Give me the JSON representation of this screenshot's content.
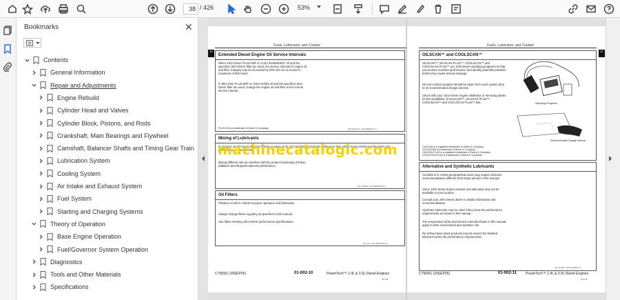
{
  "toolbar": {
    "current_page": "38",
    "total_pages": "/ 426",
    "zoom": "53%"
  },
  "bookmarks": {
    "title": "Bookmarks",
    "items": [
      {
        "label": "Contents",
        "level": 0,
        "expanded": true
      },
      {
        "label": "General Information",
        "level": 1,
        "expanded": false
      },
      {
        "label": "Repair and Adjustments",
        "level": 1,
        "expanded": true,
        "underline": true
      },
      {
        "label": "Engine Rebuild",
        "level": 2,
        "expanded": false
      },
      {
        "label": "Cylinder Head and Valves",
        "level": 2,
        "expanded": false
      },
      {
        "label": "Cylinder Block, Pistons, and Rods",
        "level": 2,
        "expanded": false
      },
      {
        "label": "Crankshaft, Main Bearings and Flywheel",
        "level": 2,
        "expanded": false
      },
      {
        "label": "Camshaft, Balancer Shafts and Timing Gear Train",
        "level": 2,
        "expanded": false
      },
      {
        "label": "Lubrication System",
        "level": 2,
        "expanded": false
      },
      {
        "label": "Cooling System",
        "level": 2,
        "expanded": false
      },
      {
        "label": "Air Intake and Exhaust System",
        "level": 2,
        "expanded": false
      },
      {
        "label": "Fuel System",
        "level": 2,
        "expanded": false
      },
      {
        "label": "Starting and Charging Systems",
        "level": 2,
        "expanded": false
      },
      {
        "label": "Theory of Operation",
        "level": 1,
        "expanded": true
      },
      {
        "label": "Base Engine Operation",
        "level": 2,
        "expanded": false
      },
      {
        "label": "Fuel/Governor System Operation",
        "level": 2,
        "expanded": false
      },
      {
        "label": "Diagnostics",
        "level": 1,
        "expanded": false
      },
      {
        "label": "Tools and Other Materials",
        "level": 1,
        "expanded": false
      },
      {
        "label": "Specifications",
        "level": 1,
        "expanded": false
      }
    ]
  },
  "left_page": {
    "header": "Fuels, Lubricants, and Coolant",
    "tab": "10",
    "sections": [
      {
        "title": "Extended Diesel Engine Oil Service Intervals",
        "paras": [
          "When John Deere PLUS-50® or ACEA-E4/E5/E6/E7 oil and the specified John Deere filter are used, the service interval for engine oil and filter changes may be increased by 50% but not to exceed a maximum of 500 hours.",
          "If other than PLUS-50® or ACEA-E4/E5 oil and the specified John Deere filter are used, change the engine oil and filter at the normal service interval."
        ],
        "note": "PLUS-50 is a trademark of Deere & Company",
        "code": "DX,ENOIL12 -19-14MAR02-1/1"
      },
      {
        "title": "Mixing of Lubricants",
        "paras": [
          "In general, avoid mixing different brands or types of oil. Oil manufacturers blend additives in their oils to meet certain specifications and performance requirements.",
          "Mixing different oils can interfere with the proper functioning of these additives and degrade lubricant performance."
        ],
        "code": "DX,LUBMIX -19-18MAR96-1/1"
      },
      {
        "title": "Oil Filters",
        "paras": [
          "Filtration of oils is critical to proper operation and lubrication.",
          "Always change filters regularly as specified in this manual.",
          "Use filters meeting John Deere performance specifications."
        ],
        "code": "DX,FILT -19-18MAR96-1/1"
      }
    ],
    "footer_left": "CTM301 (29SEP05)",
    "footer_center": "01-002-10",
    "footer_right": "PowerTech™ 2.4L & 3.0L Diesel Engines",
    "footer_page": "PN=38"
  },
  "right_page": {
    "header": "Fuels, Lubricants, and Coolant",
    "tab": "01",
    "sections": [
      {
        "title": "OILSCAN™ and COOLSCAN™",
        "paras": [
          "OILSCAN™, OILSCAN PLUS™, COOLSCAN™ and COOLSCAN PLUS™ are John Deere sampling programs to help you monitor machine performance and identify potential problems before they cause serious damage.",
          "Oil and coolant samples should be taken from each system prior to its recommended change interval.",
          "Check with your John Deere engine distributor or servicing dealer for the availability of OILSCAN™, OILSCAN PLUS™, COOLSCAN™ and COOLSCAN PLUS™ kits."
        ],
        "caption1": "Sampling Programs",
        "caption2": "Recommended Change Interval",
        "notes": [
          "OILSCAN is a registered trademark of Deere & Company.",
          "COOLSCAN is a trademark of Deere & Company.",
          "OILSCAN PLUS is a registered trademark of Deere & Company.",
          "COOLSCAN PLUS is a trademark of Deere & Company."
        ]
      },
      {
        "title": "Alternative and Synthetic Lubricants",
        "paras": [
          "Conditions in certain geographical areas may require lubricant recommendations different from those printed in this manual.",
          "Some John Deere brand coolants and lubricants may not be available in your location.",
          "Consult your John Deere dealer to obtain information and recommendations.",
          "Synthetic lubricants may be used if they meet the performance requirements as shown in this manual.",
          "The temperature limits and service intervals shown in this manual apply to both conventional and synthetic oils.",
          "Re-refined base stock products may be used if the finished lubricant meets the performance requirements."
        ],
        "code": "DX,ALTER -19-15JUN00-1/1"
      }
    ],
    "footer_left": "CTM301 (29SEP05)",
    "footer_center": "01-002-11",
    "footer_right": "PowerTech™ 2.4L & 3.0L Diesel Engines",
    "footer_page": "PN=39"
  },
  "watermark": "machinecatalogic.com"
}
